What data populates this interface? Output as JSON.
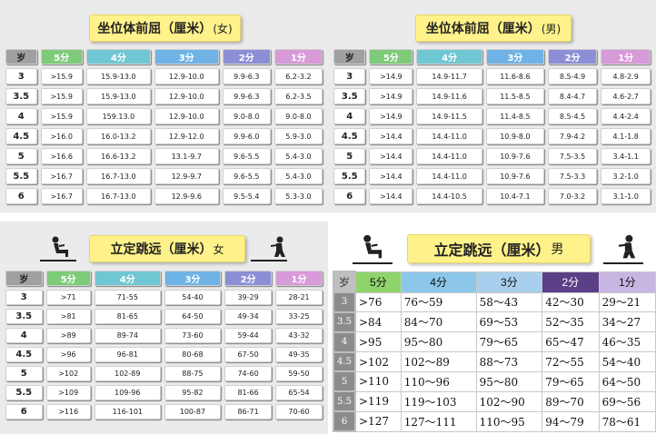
{
  "header_colors": [
    "#a0a0a0",
    "#7ecb7a",
    "#6fc7d3",
    "#6fb3e6",
    "#8c8fd6",
    "#d89ad8"
  ],
  "plain_header_colors": [
    "#bfbfbf",
    "#8fd36b",
    "#8cc7ea",
    "#a8d0ee",
    "#5b3f87",
    "#c8b6e2"
  ],
  "icons": [
    "sitting-figure-icon",
    "standing-jump-figure-icon"
  ],
  "tables": [
    {
      "title": "坐位体前屈（厘米）",
      "gender": "(女)",
      "headers": [
        "岁",
        "5分",
        "4分",
        "3分",
        "2分",
        "1分"
      ],
      "rows": [
        [
          "3",
          ">15.9",
          "15.9-13.0",
          "12.9-10.0",
          "9.9-6.3",
          "6.2-3.2"
        ],
        [
          "3.5",
          ">15.9",
          "15.9-13.0",
          "12.9-10.0",
          "9.9-6.3",
          "6.2-3.5"
        ],
        [
          "4",
          ">15.9",
          "159.13.0",
          "12.9-10.0",
          "9.0-8.0",
          "9.0-8.0"
        ],
        [
          "4.5",
          ">16.0",
          "16.0-13.2",
          "12.9-12.0",
          "9.9-6.0",
          "5.9-3.0"
        ],
        [
          "5",
          ">16.6",
          "16.6-13.2",
          "13.1-9.7",
          "9.6-5.5",
          "5.4-3.0"
        ],
        [
          "5.5",
          ">16.7",
          "16.7-13.0",
          "12.9-9.7",
          "9.6-5.5",
          "5.4-3.0"
        ],
        [
          "6",
          ">16.7",
          "16.7-13.0",
          "12.9-9.6",
          "9.5-5.4",
          "5.3-3.0"
        ]
      ]
    },
    {
      "title": "坐位体前屈（厘米）",
      "gender": "(男)",
      "headers": [
        "岁",
        "5分",
        "4分",
        "3分",
        "2分",
        "1分"
      ],
      "rows": [
        [
          "3",
          ">14.9",
          "14.9-11.7",
          "11.6-8.6",
          "8.5-4.9",
          "4.8-2.9"
        ],
        [
          "3.5",
          ">14.9",
          "14.9-11.6",
          "11.5-8.5",
          "8.4-4.7",
          "4.6-2.7"
        ],
        [
          "4",
          ">14.9",
          "14.9-11.5",
          "11.4-8.5",
          "8.5-4.5",
          "4.4-2.4"
        ],
        [
          "4.5",
          ">14.4",
          "14.4-11.0",
          "10.9-8.0",
          "7.9-4.2",
          "4.1-1.8"
        ],
        [
          "5",
          ">14.4",
          "14.4-11.0",
          "10.9-7.6",
          "7.5-3.5",
          "3.4-1.1"
        ],
        [
          "5.5",
          ">14.4",
          "14.4-11.0",
          "10.9-7.6",
          "7.5-3.3",
          "3.2-1.0"
        ],
        [
          "6",
          ">14.4",
          "14.4-10.5",
          "10.4-7.1",
          "7.0-3.2",
          "3.1-1.0"
        ]
      ]
    },
    {
      "title": "立定跳远（厘米）",
      "gender": "女",
      "headers": [
        "岁",
        "5分",
        "4分",
        "3分",
        "2分",
        "1分"
      ],
      "rows": [
        [
          "3",
          ">71",
          "71-55",
          "54-40",
          "39-29",
          "28-21"
        ],
        [
          "3.5",
          ">81",
          "81-65",
          "64-50",
          "49-34",
          "33-25"
        ],
        [
          "4",
          ">89",
          "89-74",
          "73-60",
          "59-44",
          "43-32"
        ],
        [
          "4.5",
          ">96",
          "96-81",
          "80-68",
          "67-50",
          "49-35"
        ],
        [
          "5",
          ">102",
          "102-89",
          "88-75",
          "74-60",
          "59-50"
        ],
        [
          "5.5",
          ">109",
          "109-96",
          "95-82",
          "81-66",
          "65-54"
        ],
        [
          "6",
          ">116",
          "116-101",
          "100-87",
          "86-71",
          "70-60"
        ]
      ]
    },
    {
      "title": "立定跳远（厘米）",
      "gender": "男",
      "headers": [
        "岁",
        "5分",
        "4分",
        "3分",
        "2分",
        "1分"
      ],
      "rows": [
        [
          "3",
          ">76",
          "76～59",
          "58～43",
          "42～30",
          "29～21"
        ],
        [
          "3.5",
          ">84",
          "84～70",
          "69～53",
          "52～35",
          "34～27"
        ],
        [
          "4",
          ">95",
          "95～80",
          "79～65",
          "65～47",
          "46～35"
        ],
        [
          "4.5",
          ">102",
          "102～89",
          "88～73",
          "72～55",
          "54～40"
        ],
        [
          "5",
          ">110",
          "110～96",
          "95～80",
          "79～65",
          "64～50"
        ],
        [
          "5.5",
          ">119",
          "119～103",
          "102～90",
          "89～70",
          "69～56"
        ],
        [
          "6",
          ">127",
          "127～111",
          "110～95",
          "94～79",
          "78～61"
        ]
      ]
    }
  ]
}
